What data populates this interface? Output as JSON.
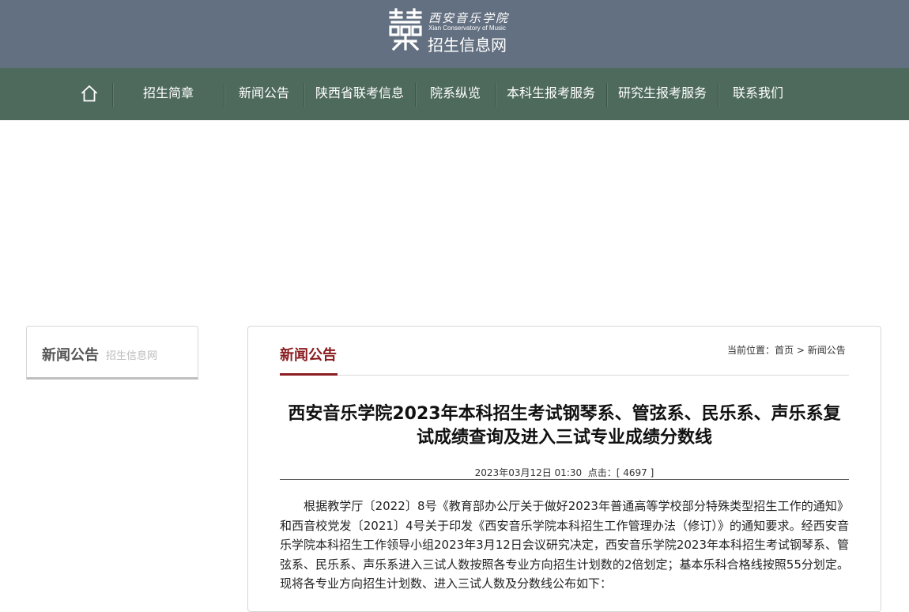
{
  "header": {
    "logo_cn": "西安音乐学院",
    "logo_en": "Xian Conservatory of Music",
    "logo_sub": "招生信息网"
  },
  "nav": {
    "home_icon": "home-icon",
    "items": [
      {
        "label": "招生简章"
      },
      {
        "label": "新闻公告"
      },
      {
        "label": "陕西省联考信息"
      },
      {
        "label": "院系纵览"
      },
      {
        "label": "本科生报考服务"
      },
      {
        "label": "研究生报考服务"
      },
      {
        "label": "联系我们"
      }
    ]
  },
  "sidebar": {
    "title": "新闻公告",
    "subtitle": "招生信息网"
  },
  "main": {
    "section_title": "新闻公告",
    "breadcrumb": {
      "prefix": "当前位置：",
      "home": "首页",
      "sep": ">",
      "current": "新闻公告"
    },
    "article": {
      "title": "西安音乐学院2023年本科招生考试钢琴系、管弦系、民乐系、声乐系复试成绩查询及进入三试专业成绩分数线",
      "date": "2023年03月12日 01:30",
      "hits_label": "点击：[ 4697 ]",
      "paragraph": "根据教学厅〔2022〕8号《教育部办公厅关于做好2023年普通高等学校部分特殊类型招生工作的通知》和西音校党发〔2021〕4号关于印发《西安音乐学院本科招生工作管理办法（修订）》的通知要求。经西安音乐学院本科招生工作领导小组2023年3月12日会议研究决定，西安音乐学院2023年本科招生考试钢琴系、管弦系、民乐系、声乐系进入三试人数按照各专业方向招生计划数的2倍划定；基本乐科合格线按照55分划定。现将各专业方向招生计划数、进入三试人数及分数线公布如下："
    }
  },
  "colors": {
    "topbar": "#637081",
    "nav": "#4e6a5c",
    "accent": "#8b1c20"
  }
}
